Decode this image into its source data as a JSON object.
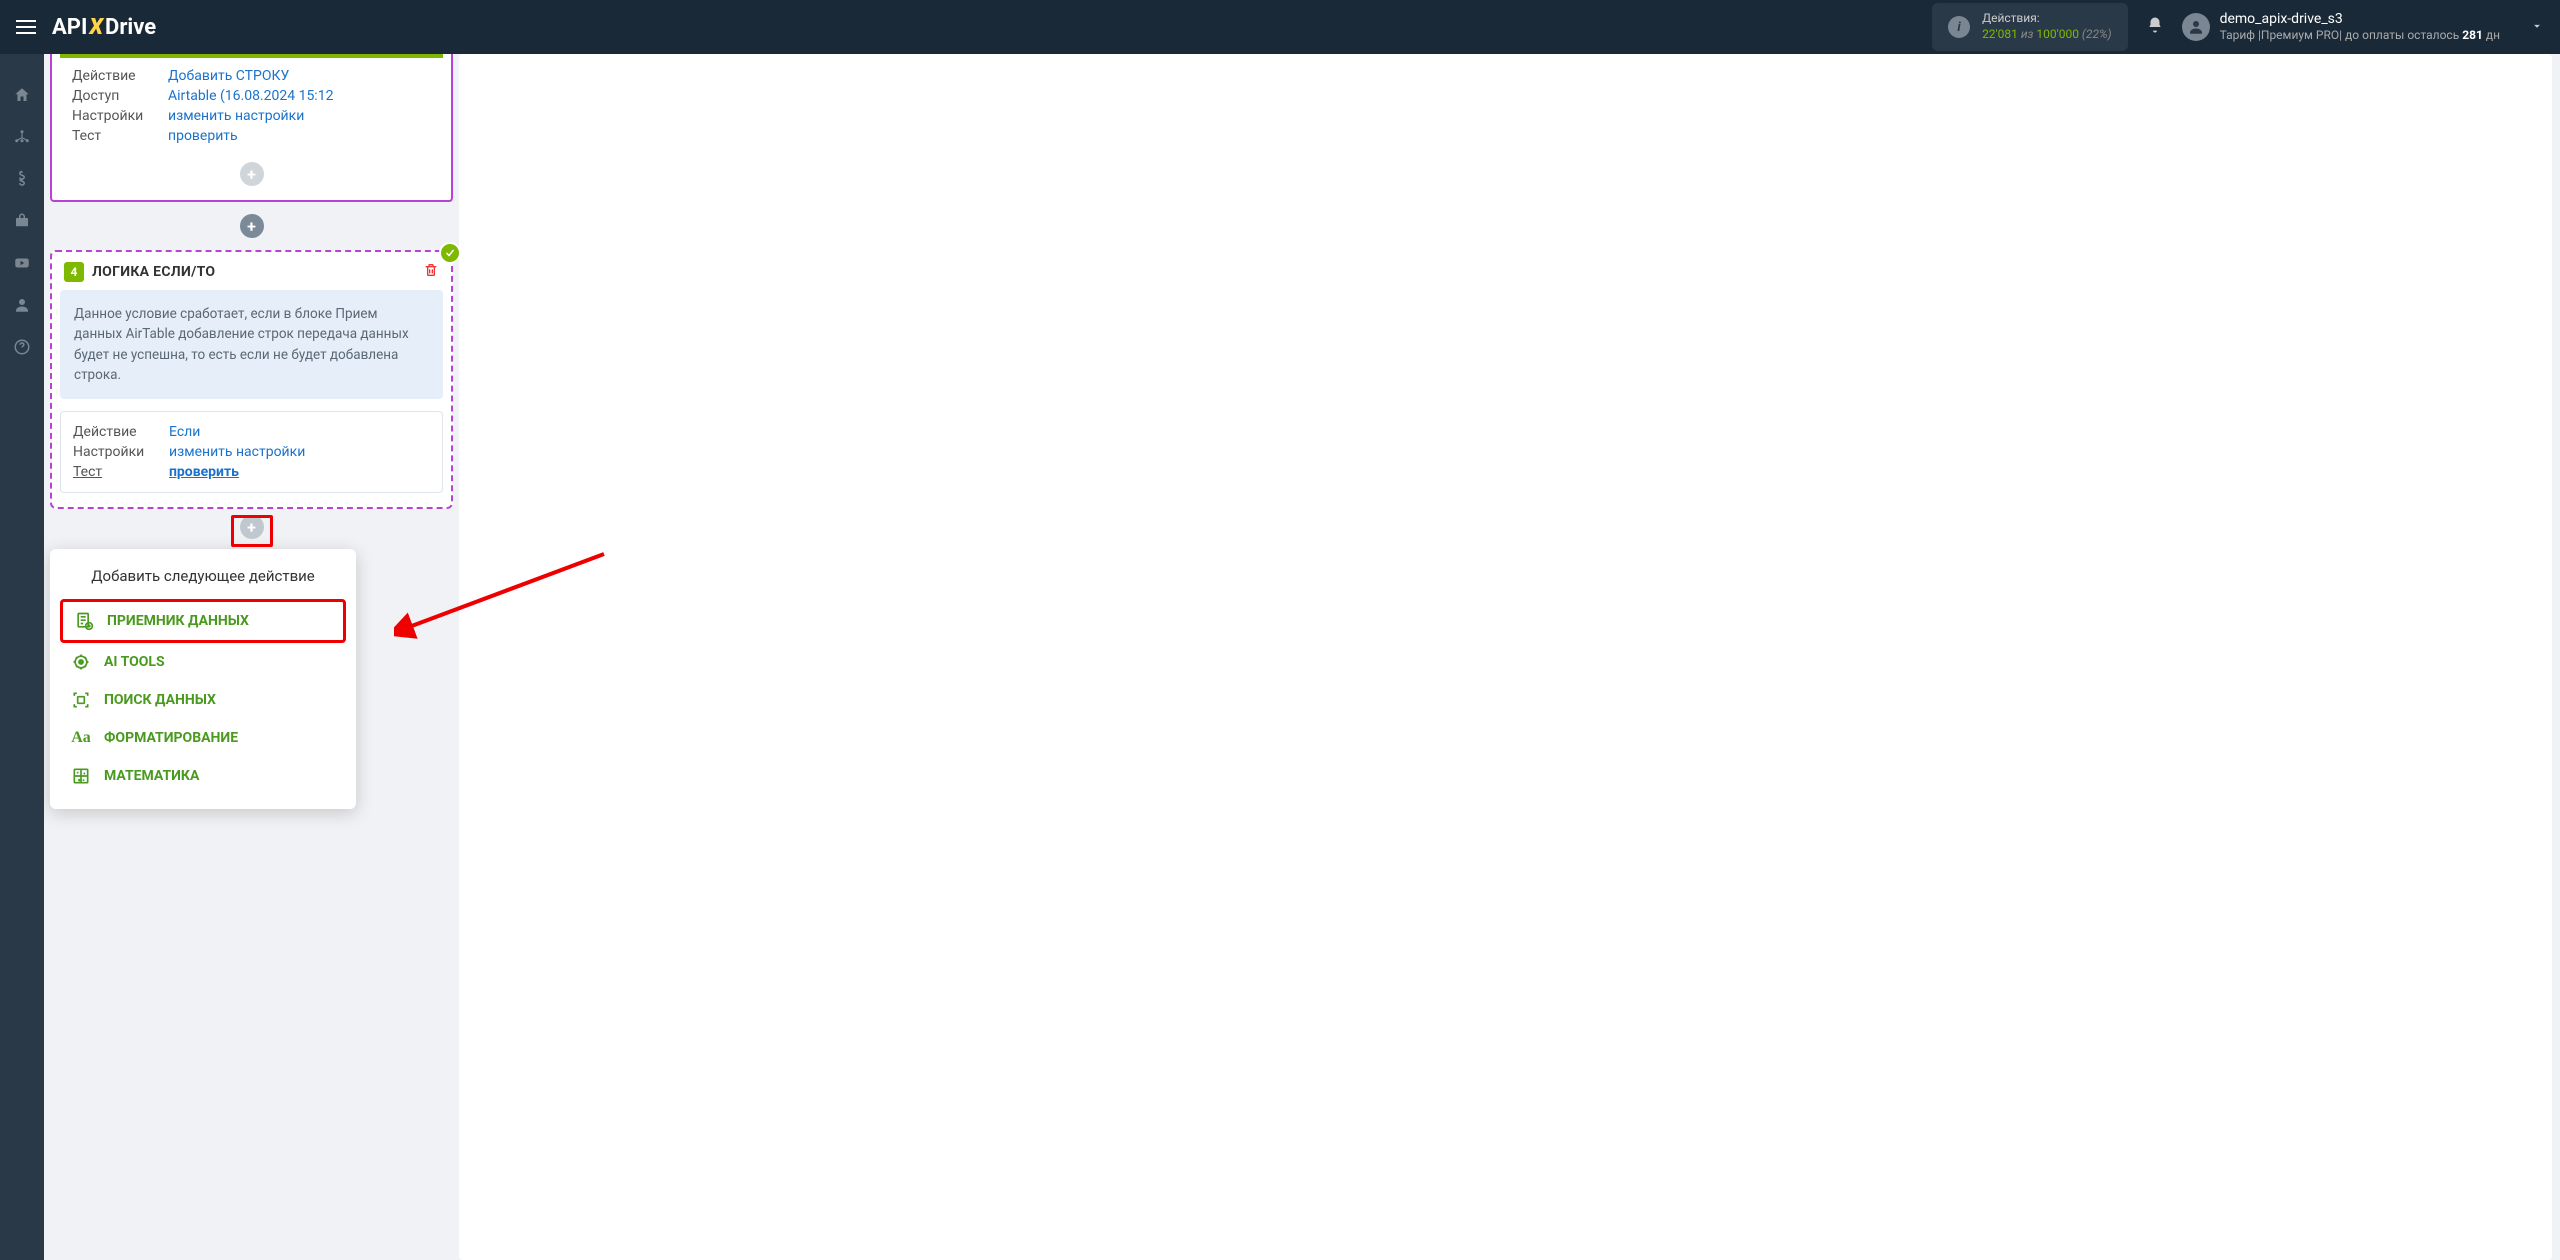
{
  "header": {
    "logo_pre": "API",
    "logo_x": "X",
    "logo_post": "Drive",
    "actions_label": "Действия:",
    "actions_current": "22'081",
    "actions_sep": " из ",
    "actions_max": "100'000",
    "actions_pct": " (22%)",
    "user_name": "demo_apix-drive_s3",
    "tariff_prefix": "Тариф |Премиум PRO| до оплаты осталось ",
    "tariff_days": "281",
    "tariff_suffix": " дн"
  },
  "sidebar": {
    "items": [
      "home",
      "connections",
      "billing",
      "workspace",
      "video",
      "profile",
      "help"
    ]
  },
  "block_purple": {
    "action_label": "Действие",
    "action_value": "Добавить СТРОКУ",
    "access_label": "Доступ",
    "access_value": "Airtable (16.08.2024 15:12",
    "settings_label": "Настройки",
    "settings_value": "изменить настройки",
    "test_label": "Тест",
    "test_value": "проверить"
  },
  "block_logic": {
    "number": "4",
    "title": "ЛОГИКА ЕСЛИ/ТО",
    "description": "Данное условие сработает, если в блоке Прием данных AirTable добавление строк передача данных будет не успешна, то есть если не будет добавлена строка.",
    "action_label": "Действие",
    "action_value": "Если",
    "settings_label": "Настройки",
    "settings_value": "изменить настройки",
    "test_label": "Тест",
    "test_value": "проверить"
  },
  "popup": {
    "title": "Добавить следующее действие",
    "items": [
      {
        "label": "ПРИЕМНИК ДАННЫХ",
        "icon": "doc-plus-icon",
        "highlight": true
      },
      {
        "label": "AI TOOLS",
        "icon": "brain-icon"
      },
      {
        "label": "ПОИСК ДАННЫХ",
        "icon": "scan-icon"
      },
      {
        "label": "ФОРМАТИРОВАНИЕ",
        "icon": "aa-icon"
      },
      {
        "label": "МАТЕМАТИКА",
        "icon": "calc-icon"
      }
    ]
  }
}
